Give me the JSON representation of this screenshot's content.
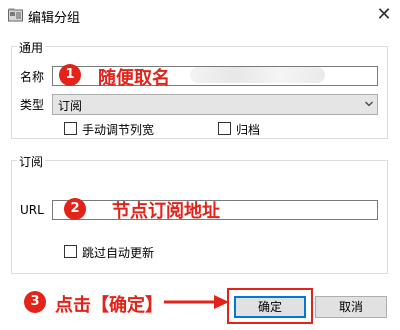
{
  "window": {
    "title": "编辑分组",
    "close_glyph": "✕"
  },
  "general": {
    "legend": "通用",
    "name_label": "名称",
    "name_value": "",
    "type_label": "类型",
    "type_value": "订阅",
    "checkbox_manual_cols": {
      "label": "手动调节列宽",
      "checked": false
    },
    "checkbox_archive": {
      "label": "归档",
      "checked": false
    }
  },
  "subscription": {
    "legend": "订阅",
    "url_label": "URL",
    "url_value": "",
    "checkbox_skip_update": {
      "label": "跳过自动更新",
      "checked": false
    }
  },
  "annotations": [
    {
      "num": "1",
      "text": "随便取名"
    },
    {
      "num": "2",
      "text": "节点订阅地址"
    },
    {
      "num": "3",
      "text": "点击【确定】"
    }
  ],
  "buttons": {
    "ok": "确定",
    "cancel": "取消"
  },
  "colors": {
    "annotation_red": "#e2231a",
    "focus_blue": "#0078d7"
  },
  "icons": [
    "app-icon",
    "close-icon",
    "dropdown-arrow-icon",
    "arrow-right-icon"
  ]
}
